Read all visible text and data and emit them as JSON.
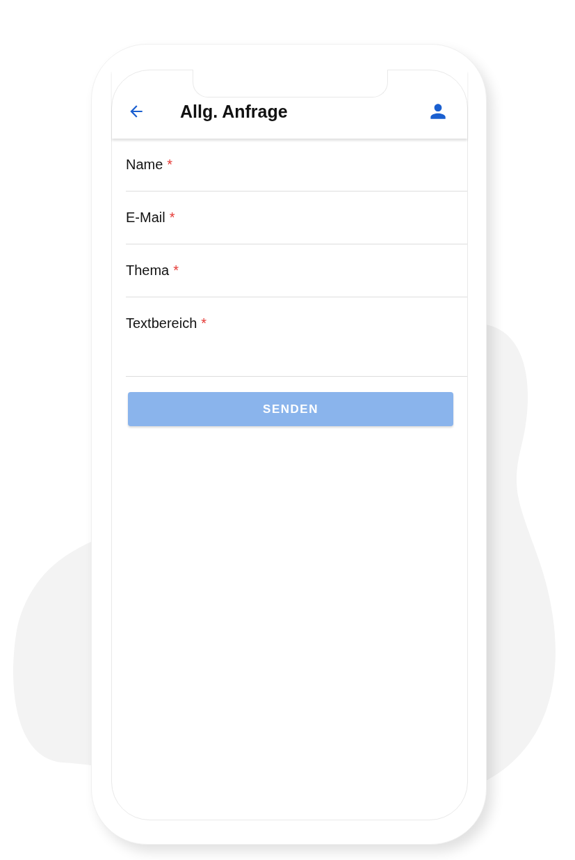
{
  "header": {
    "title": "Allg. Anfrage"
  },
  "fields": [
    {
      "kind": "input",
      "label": "Name",
      "required_mark": "*"
    },
    {
      "kind": "input",
      "label": "E-Mail",
      "required_mark": "*"
    },
    {
      "kind": "input",
      "label": "Thema",
      "required_mark": "*"
    },
    {
      "kind": "textarea",
      "label": "Textbereich",
      "required_mark": "*"
    }
  ],
  "submit_button": {
    "label": "SENDEN",
    "disabled": true
  }
}
